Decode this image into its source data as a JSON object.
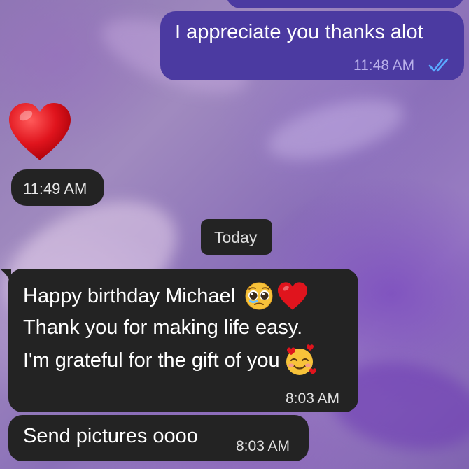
{
  "messages": [
    {
      "id": "out-1",
      "direction": "outgoing",
      "text": "I appreciate you thanks alot",
      "time": "11:48 AM",
      "status": "read"
    },
    {
      "id": "in-heart",
      "direction": "incoming",
      "emoji": "red-heart",
      "time": "11:49 AM"
    },
    {
      "id": "in-2",
      "direction": "incoming",
      "lines": [
        "Happy birthday Michael",
        "Thank you for making life easy.",
        "I'm grateful for the gift of you"
      ],
      "emojis": [
        "pleading-face",
        "red-heart",
        "smiling-face-with-hearts"
      ],
      "time": "8:03 AM"
    },
    {
      "id": "in-3",
      "direction": "incoming",
      "text": "Send pictures oooo",
      "time": "8:03 AM"
    }
  ],
  "date_separator": "Today",
  "colors": {
    "outgoing_bubble": "#4b3aa1",
    "incoming_bubble": "#232323",
    "read_check": "#5aa8ff"
  },
  "icons": {
    "read_receipt": "double-check-icon",
    "bubble_tail": "bubble-tail-icon"
  }
}
